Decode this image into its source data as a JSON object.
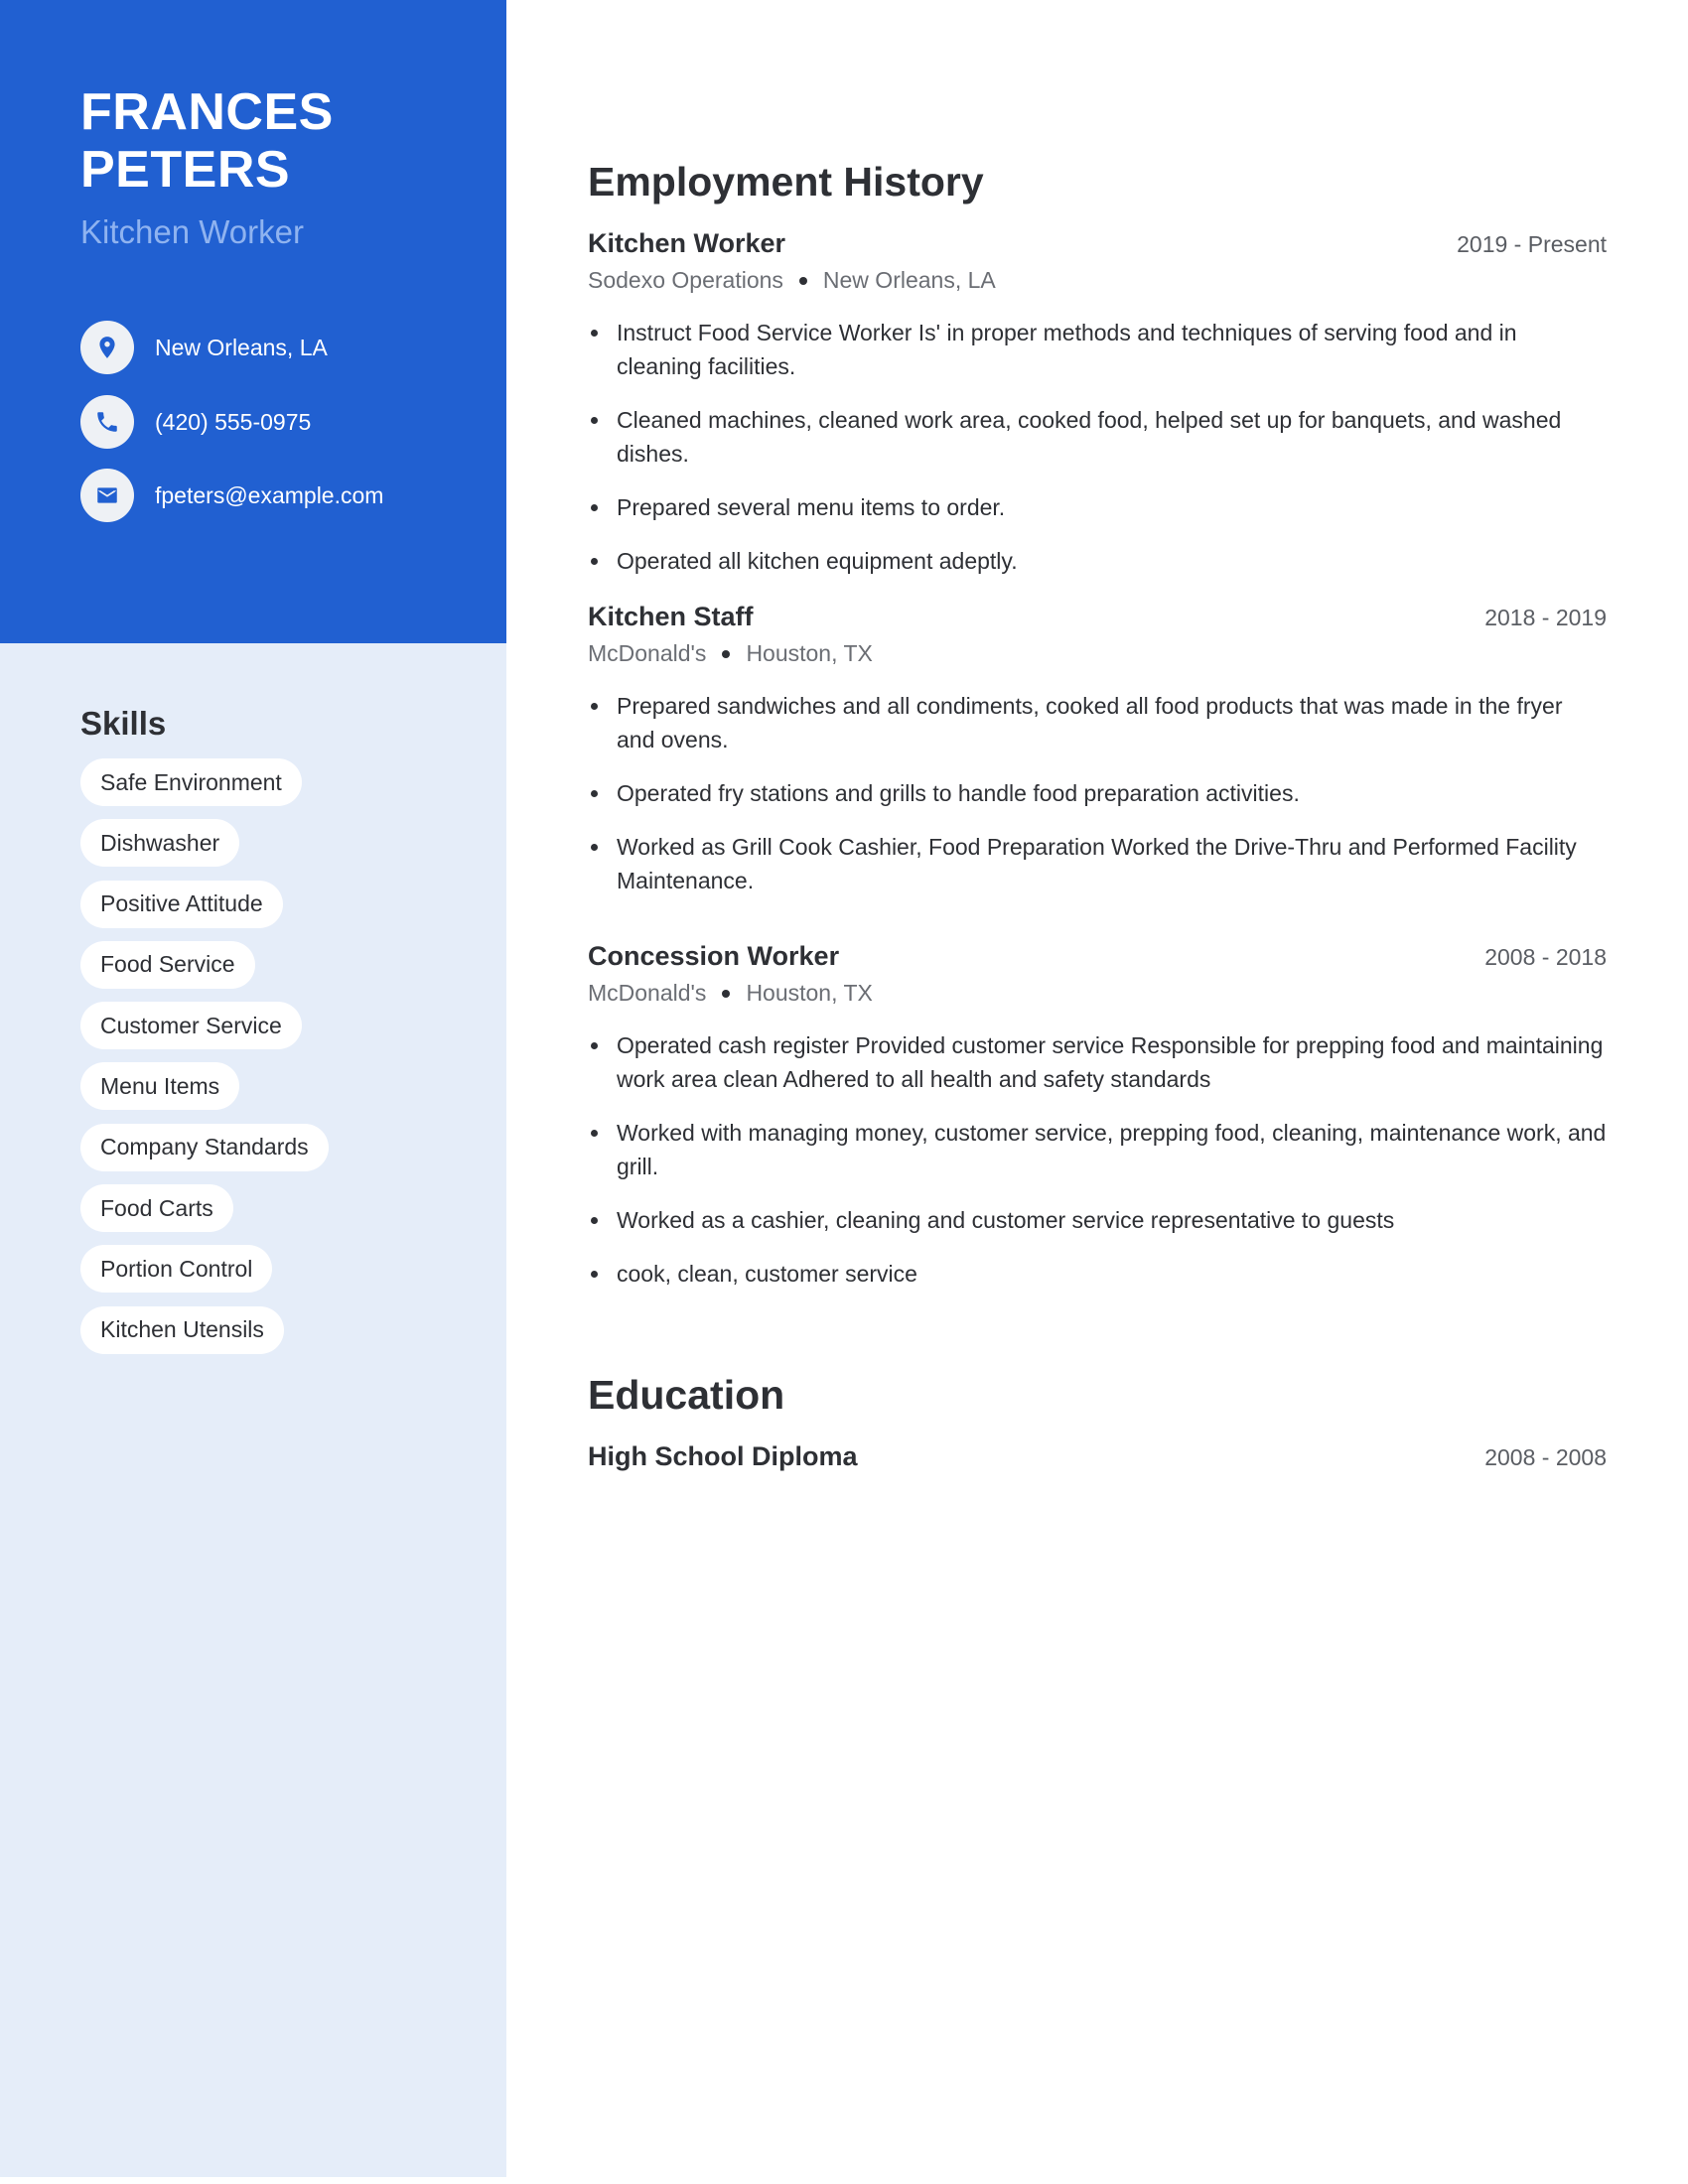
{
  "profile": {
    "first_name": "FRANCES",
    "last_name": "PETERS",
    "title": "Kitchen Worker"
  },
  "contact": {
    "location": {
      "icon": "location-pin-icon",
      "text": "New Orleans, LA"
    },
    "phone": {
      "icon": "phone-icon",
      "text": "(420) 555-0975"
    },
    "email": {
      "icon": "envelope-icon",
      "text": "fpeters@example.com"
    }
  },
  "skills": {
    "title": "Skills",
    "items": [
      "Safe Environment",
      "Dishwasher",
      "Positive Attitude",
      "Food Service",
      "Customer Service",
      "Menu Items",
      "Company Standards",
      "Food Carts",
      "Portion Control",
      "Kitchen Utensils"
    ]
  },
  "employment": {
    "title": "Employment History",
    "jobs": [
      {
        "position": "Kitchen Worker",
        "dates": "2019 - Present",
        "company": "Sodexo Operations",
        "location": "New Orleans, LA",
        "bullets": [
          "Instruct Food Service Worker Is' in proper methods and techniques of serving food and in cleaning facilities.",
          "Cleaned machines, cleaned work area, cooked food, helped set up for banquets, and washed dishes.",
          "Prepared several menu items to order.",
          "Operated all kitchen equipment adeptly."
        ]
      },
      {
        "position": "Kitchen Staff",
        "dates": "2018 - 2019",
        "company": "McDonald's",
        "location": "Houston, TX",
        "bullets": [
          "Prepared sandwiches and all condiments, cooked all food products that was made in the fryer and ovens.",
          "Operated fry stations and grills to handle food preparation activities.",
          "Worked as Grill Cook Cashier, Food Preparation Worked the Drive-Thru and Performed Facility Maintenance."
        ]
      },
      {
        "position": "Concession Worker",
        "dates": "2008 - 2018",
        "company": "McDonald's",
        "location": "Houston, TX",
        "bullets": [
          "Operated cash register Provided customer service Responsible for prepping food and maintaining work area clean Adhered to all health and safety standards",
          "Worked with managing money, customer service, prepping food, cleaning, maintenance work, and grill.",
          "Worked as a cashier, cleaning and customer service representative to guests",
          "cook, clean, customer service"
        ]
      }
    ]
  },
  "education": {
    "title": "Education",
    "items": [
      {
        "degree": "High School Diploma",
        "dates": "2008 - 2008"
      }
    ]
  },
  "colors": {
    "accent": "#2160d1",
    "sidebar_bg": "#e5edf9",
    "title_muted": "#8fb3f0",
    "text": "#2e3035"
  }
}
